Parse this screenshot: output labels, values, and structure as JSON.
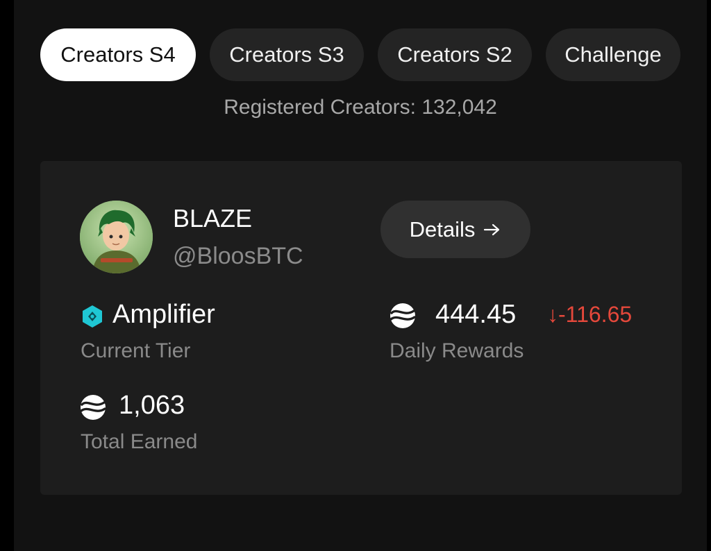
{
  "tabs": [
    {
      "label": "Creators S4",
      "active": true
    },
    {
      "label": "Creators S3",
      "active": false
    },
    {
      "label": "Creators S2",
      "active": false
    },
    {
      "label": "Challenge",
      "active": false
    }
  ],
  "registered_creators": "Registered Creators: 132,042",
  "profile": {
    "name": "BLAZE",
    "handle": "@BloosBTC",
    "avatar_icon": "avatar-image",
    "details_label": "Details",
    "details_icon": "arrow-right-icon"
  },
  "tier": {
    "value": "Amplifier",
    "label": "Current Tier",
    "icon": "tier-hexagon-icon",
    "color": "#1fc7d4"
  },
  "daily_rewards": {
    "value": "444.45",
    "change": "↓-116.65",
    "label": "Daily Rewards",
    "icon": "token-icon",
    "change_color": "#e5483b"
  },
  "total_earned": {
    "value": "1,063",
    "label": "Total Earned",
    "icon": "token-icon"
  }
}
